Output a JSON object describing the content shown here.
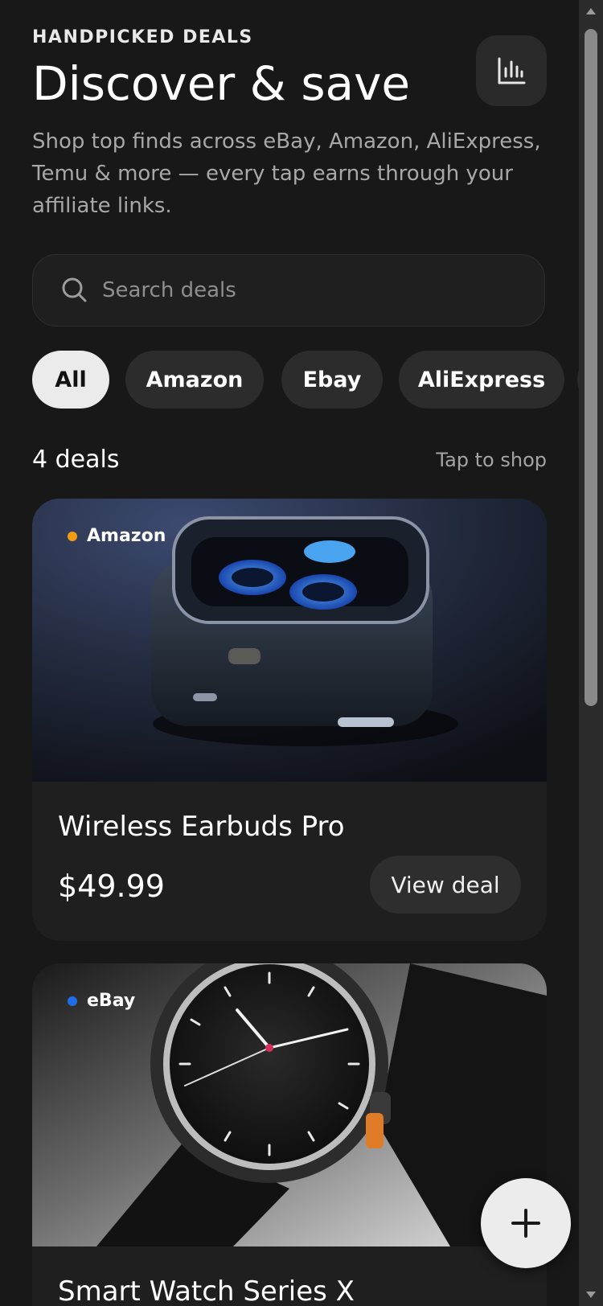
{
  "header": {
    "eyebrow": "HANDPICKED DEALS",
    "title": "Discover & save",
    "subtitle": "Shop top finds across eBay, Amazon, AliExpress, Temu & more — every tap earns through your affiliate links.",
    "stats_icon": "bar-chart-icon"
  },
  "search": {
    "placeholder": "Search deals",
    "icon": "search-icon"
  },
  "filters": [
    {
      "label": "All",
      "active": true
    },
    {
      "label": "Amazon",
      "active": false
    },
    {
      "label": "Ebay",
      "active": false
    },
    {
      "label": "AliExpress",
      "active": false
    }
  ],
  "summary": {
    "count": "4 deals",
    "hint": "Tap to shop"
  },
  "deals": [
    {
      "store": "Amazon",
      "store_color": "#f39c12",
      "name": "Wireless Earbuds Pro",
      "price": "$49.99",
      "cta": "View deal"
    },
    {
      "store": "eBay",
      "store_color": "#1e6ee8",
      "name": "Smart Watch Series X",
      "price": "",
      "cta": ""
    }
  ],
  "fab": {
    "icon": "plus-icon"
  }
}
